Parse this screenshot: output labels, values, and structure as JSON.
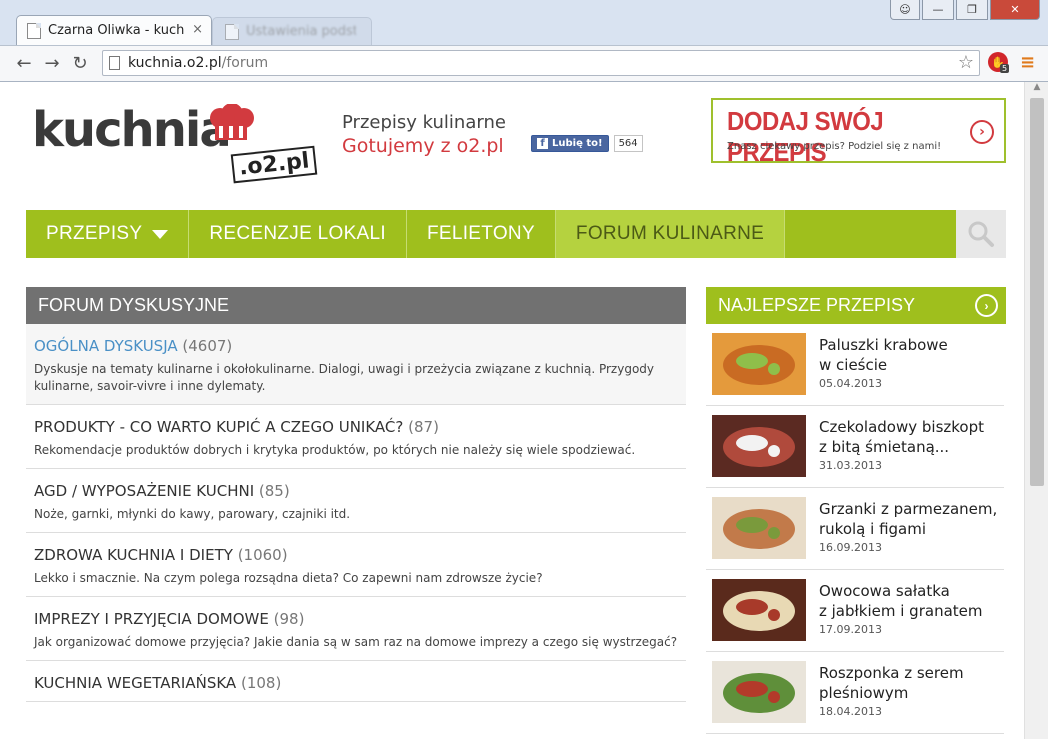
{
  "browser": {
    "tab_title": "Czarna Oliwka - kuch",
    "tab2_title": "Ustawienia podstawowe",
    "url_host": "kuchnia.o2.pl",
    "url_path": "/forum",
    "extension_badge": "5"
  },
  "header": {
    "logo_text": "kuchnia",
    "logo_domain": ".o2.pl",
    "tagline_1": "Przepisy kulinarne",
    "tagline_2": "Gotujemy z o2.pl",
    "fb_like_label": "Lubię to!",
    "fb_like_count": "564",
    "add_recipe_title": "DODAJ SWÓJ PRZEPIS",
    "add_recipe_subtitle": "Znasz ciekawy przepis? Podziel się z nami!"
  },
  "nav": {
    "items": [
      {
        "label": "PRZEPISY"
      },
      {
        "label": "RECENZJE LOKALI"
      },
      {
        "label": "FELIETONY"
      },
      {
        "label": "FORUM KULINARNE"
      }
    ]
  },
  "forum": {
    "title": "FORUM DYSKUSYJNE",
    "categories": [
      {
        "name": "OGÓLNA DYSKUSJA",
        "count": "(4607)",
        "desc": "Dyskusje na tematy kulinarne i okołokulinarne. Dialogi, uwagi i przeżycia związane z kuchnią. Przygody kulinarne, savoir-vivre i inne dylematy."
      },
      {
        "name": "PRODUKTY - CO WARTO KUPIĆ A CZEGO UNIKAĆ?",
        "count": "(87)",
        "desc": "Rekomendacje produktów dobrych i krytyka produktów, po których nie należy się wiele spodziewać."
      },
      {
        "name": "AGD / WYPOSAŻENIE KUCHNI",
        "count": "(85)",
        "desc": "Noże, garnki, młynki do kawy, parowary, czajniki itd."
      },
      {
        "name": "ZDROWA KUCHNIA I DIETY",
        "count": "(1060)",
        "desc": "Lekko i smacznie. Na czym polega rozsądna dieta? Co zapewni nam zdrowsze życie?"
      },
      {
        "name": "IMPREZY I PRZYJĘCIA DOMOWE",
        "count": "(98)",
        "desc": "Jak organizować domowe przyjęcia? Jakie dania są w sam raz na domowe imprezy a czego się wystrzegać?"
      },
      {
        "name": "KUCHNIA WEGETARIAŃSKA",
        "count": "(108)",
        "desc": ""
      }
    ]
  },
  "best": {
    "title": "NAJLEPSZE PRZEPISY",
    "recipes": [
      {
        "title": "Paluszki krabowe\nw cieście",
        "date": "05.04.2013",
        "colors": [
          "#e49a3c",
          "#c96b23",
          "#8fbf4a"
        ]
      },
      {
        "title": "Czekoladowy biszkopt\nz bitą śmietaną...",
        "date": "31.03.2013",
        "colors": [
          "#5b2a22",
          "#b04a3c",
          "#f2f2f2"
        ]
      },
      {
        "title": "Grzanki z parmezanem,\nrukolą i figami",
        "date": "16.09.2013",
        "colors": [
          "#e8dcc8",
          "#c27a4a",
          "#7a9a3c"
        ]
      },
      {
        "title": "Owocowa sałatka\nz jabłkiem i granatem",
        "date": "17.09.2013",
        "colors": [
          "#5a2a1c",
          "#e8d9b4",
          "#a83a2a"
        ]
      },
      {
        "title": "Roszponka z serem\npleśniowym",
        "date": "18.04.2013",
        "colors": [
          "#e9e4da",
          "#5f8f3a",
          "#b33a2a"
        ]
      }
    ]
  }
}
